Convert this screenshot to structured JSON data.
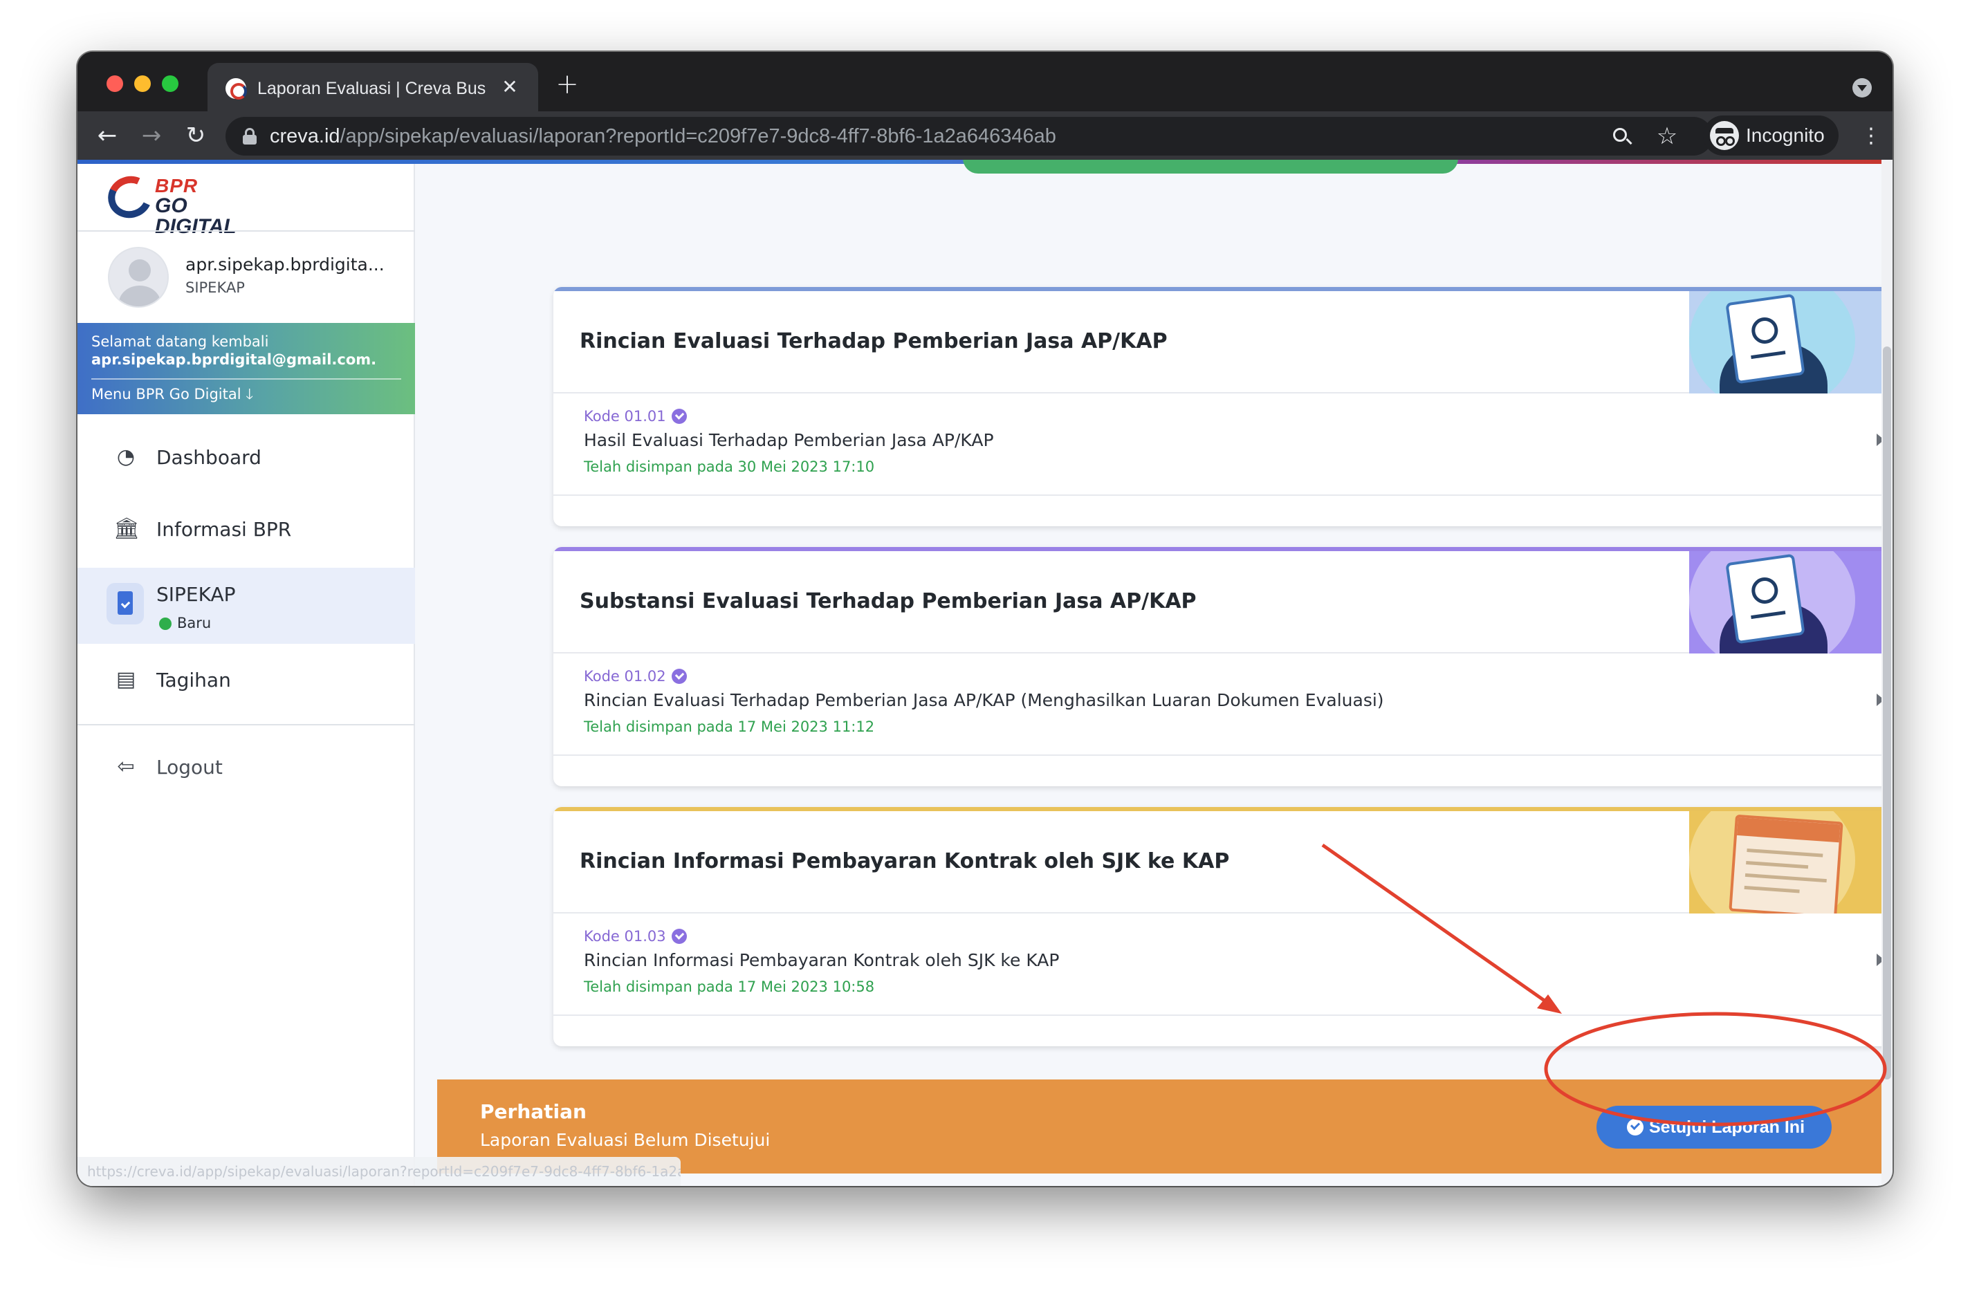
{
  "browser": {
    "tab_title": "Laporan Evaluasi | Creva Business",
    "tab_close": "✕",
    "new_tab": "+",
    "url_host": "creva.id",
    "url_path": "/app/sipekap/evaluasi/laporan?reportId=c209f7e7-9dc8-4ff7-8bf6-1a2a646346ab",
    "incognito_label": "Incognito",
    "nav_back": "←",
    "nav_forward": "→",
    "nav_reload": "↻",
    "star": "☆",
    "menu": "⋮"
  },
  "sidebar": {
    "logo_top": "BPR",
    "logo_bottom": "GO DIGITAL",
    "user": {
      "email": "apr.sipekap.bprdigita...",
      "role": "SIPEKAP"
    },
    "welcome": {
      "line1": "Selamat datang kembali",
      "line2": "apr.sipekap.bprdigital@gmail.com.",
      "menu": "Menu BPR Go Digital 🡓"
    },
    "items": [
      {
        "label": "Dashboard",
        "icon": "dashboard-icon",
        "glyph": "◔"
      },
      {
        "label": "Informasi BPR",
        "icon": "bank-icon",
        "glyph": "🏛"
      },
      {
        "label": "SIPEKAP",
        "icon": "clipboard-check-icon",
        "badge": "Baru"
      },
      {
        "label": "Tagihan",
        "icon": "invoice-icon",
        "glyph": "▤"
      },
      {
        "label": "Logout",
        "icon": "logout-icon",
        "glyph": "⇦"
      }
    ]
  },
  "cards": [
    {
      "title": "Rincian Evaluasi Terhadap Pemberian Jasa AP/KAP",
      "accent": "#7e9bd8",
      "art_bg": "#bcd2f2",
      "art_circle": "#a6dbf0",
      "code": "Kode 01.01",
      "row_title": "Hasil Evaluasi Terhadap Pemberian Jasa AP/KAP",
      "saved": "Telah disimpan pada 30 Mei 2023 17:10"
    },
    {
      "title": "Substansi Evaluasi Terhadap Pemberian Jasa AP/KAP",
      "accent": "#9a82e6",
      "art_bg": "#a08cf0",
      "art_circle": "#c4b7f6",
      "code": "Kode 01.02",
      "row_title": "Rincian Evaluasi Terhadap Pemberian Jasa AP/KAP (Menghasilkan Luaran Dokumen Evaluasi)",
      "saved": "Telah disimpan pada 17 Mei 2023 11:12"
    },
    {
      "title": "Rincian Informasi Pembayaran Kontrak oleh SJK ke KAP",
      "accent": "#e9c25a",
      "art_bg": "#ebc45a",
      "art_circle": "#f2d88a",
      "code": "Kode 01.03",
      "row_title": "Rincian Informasi Pembayaran Kontrak oleh SJK ke KAP",
      "saved": "Telah disimpan pada 17 Mei 2023 10:58"
    }
  ],
  "notice": {
    "title": "Perhatian",
    "subtitle": "Laporan Evaluasi Belum Disetujui",
    "button": "Setujui Laporan Ini"
  },
  "status_url": "https://creva.id/app/sipekap/evaluasi/laporan?reportId=c209f7e7-9dc8-4ff7-8bf6-1a2a646346ab",
  "colors": {
    "notice_bg": "#e59444",
    "button_bg": "#3a78d8",
    "annotation_red": "#e2412e",
    "saved_green": "#2fa14f",
    "code_purple": "#8668d4"
  }
}
